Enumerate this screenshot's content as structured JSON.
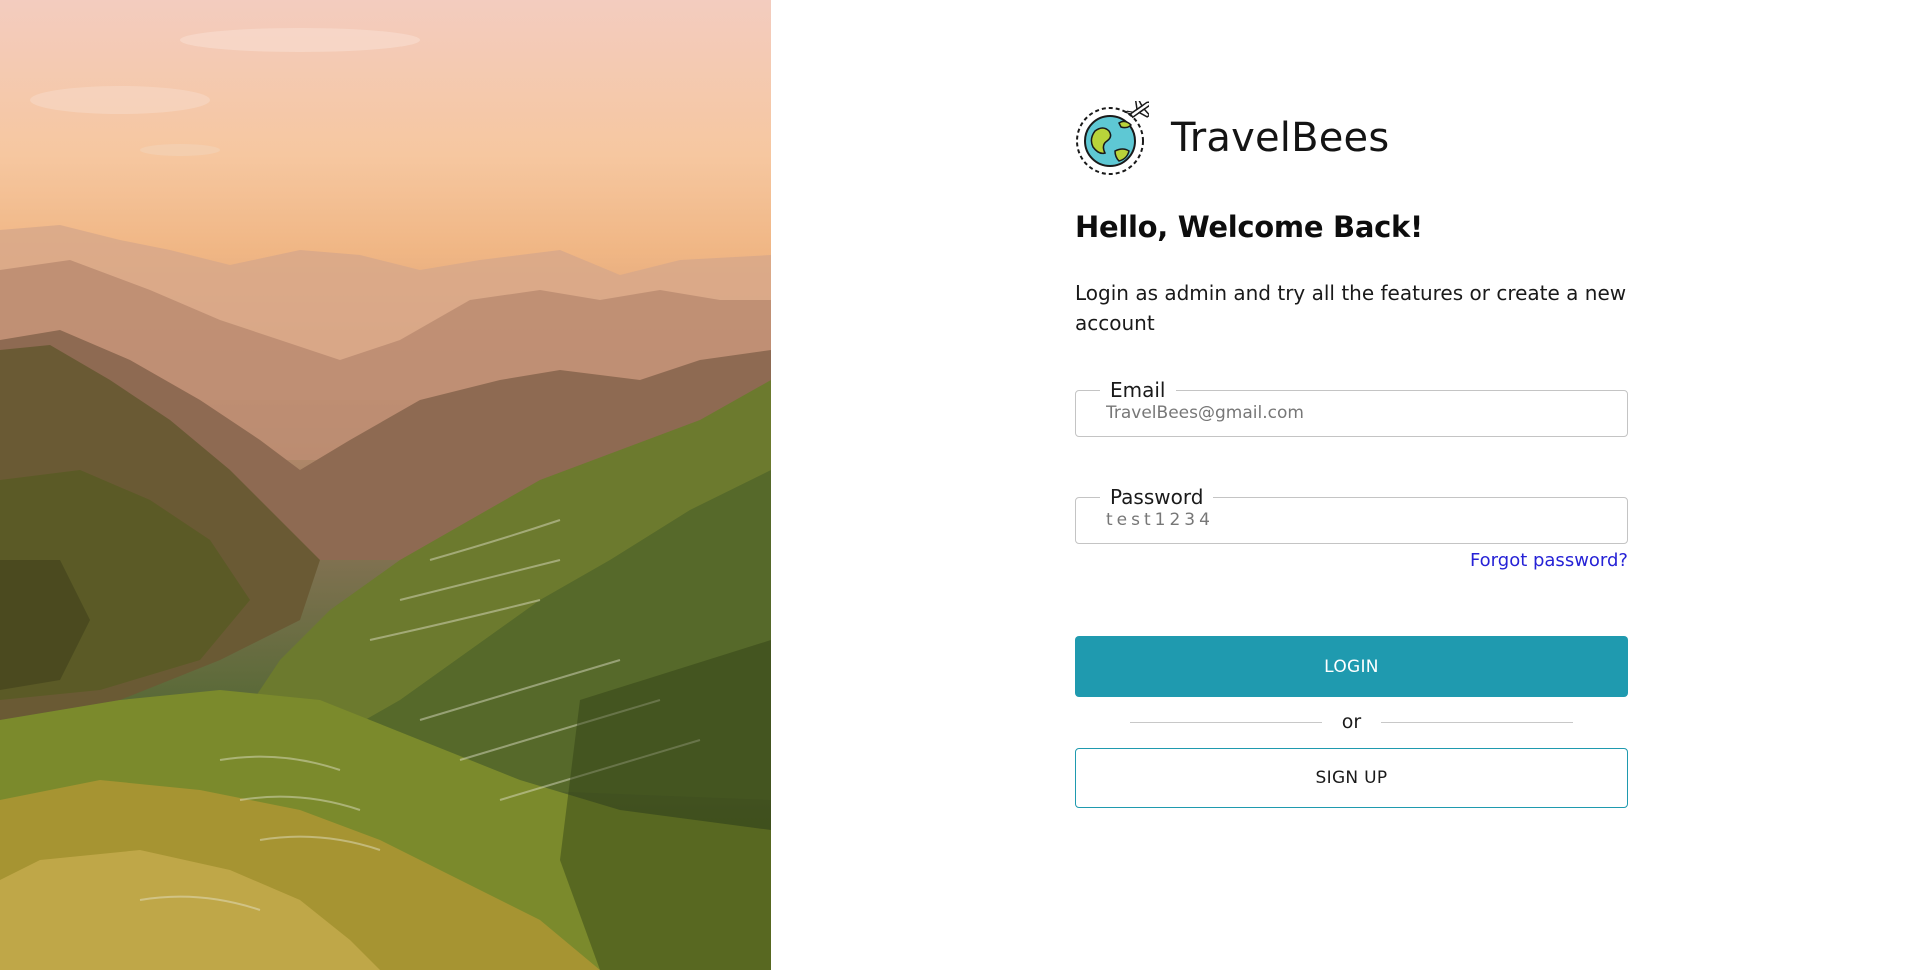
{
  "brand": {
    "name": "TravelBees",
    "logo_icon": "globe-airplane-icon"
  },
  "hero": {
    "image_subject": "mountain-rice-terraces-sunset"
  },
  "login": {
    "heading": "Hello, Welcome Back!",
    "subtext": "Login as admin and try all the features or create a new account",
    "email": {
      "label": "Email",
      "value": "TravelBees@gmail.com"
    },
    "password": {
      "label": "Password",
      "value": "test1234"
    },
    "forgot_label": "Forgot password?",
    "login_label": "LOGIN",
    "divider_label": "or",
    "signup_label": "SIGN UP"
  },
  "colors": {
    "accent": "#1f9aaf",
    "link": "#2622d6",
    "heading": "#0d0d0d"
  }
}
